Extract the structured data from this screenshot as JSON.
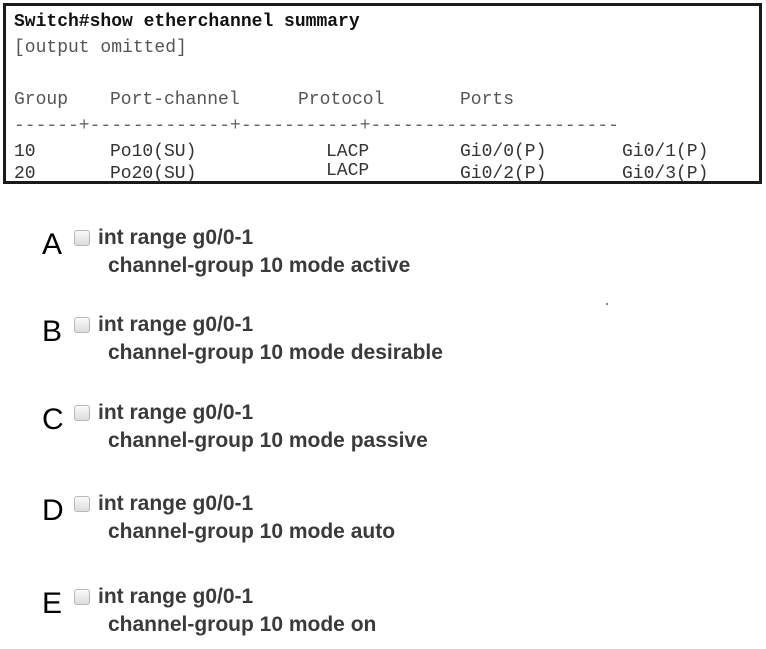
{
  "terminal": {
    "command": "Switch#show etherchannel summary",
    "omitted": "[output omitted]",
    "headers": {
      "group": "Group",
      "port_channel": "Port-channel",
      "protocol": "Protocol",
      "ports": "Ports"
    },
    "separator": "------+-------------+-----------+-----------------------",
    "rows": [
      {
        "group": "10",
        "port_channel": "Po10(SU)",
        "protocol": "LACP",
        "port1": "Gi0/0(P)",
        "port2": "Gi0/1(P)"
      },
      {
        "group": "20",
        "port_channel": "Po20(SU)",
        "protocol": "LACP",
        "port1": "Gi0/2(P)",
        "port2": "Gi0/3(P)"
      }
    ]
  },
  "options": [
    {
      "letter": "A",
      "line1": "int range g0/0-1",
      "line2": "channel-group 10 mode active"
    },
    {
      "letter": "B",
      "line1": "int range g0/0-1",
      "line2": "channel-group 10 mode desirable"
    },
    {
      "letter": "C",
      "line1": "int range g0/0-1",
      "line2": "channel-group 10 mode passive"
    },
    {
      "letter": "D",
      "line1": "int range g0/0-1",
      "line2": "channel-group 10 mode auto"
    },
    {
      "letter": "E",
      "line1": "int range g0/0-1",
      "line2": "channel-group 10 mode on"
    }
  ]
}
